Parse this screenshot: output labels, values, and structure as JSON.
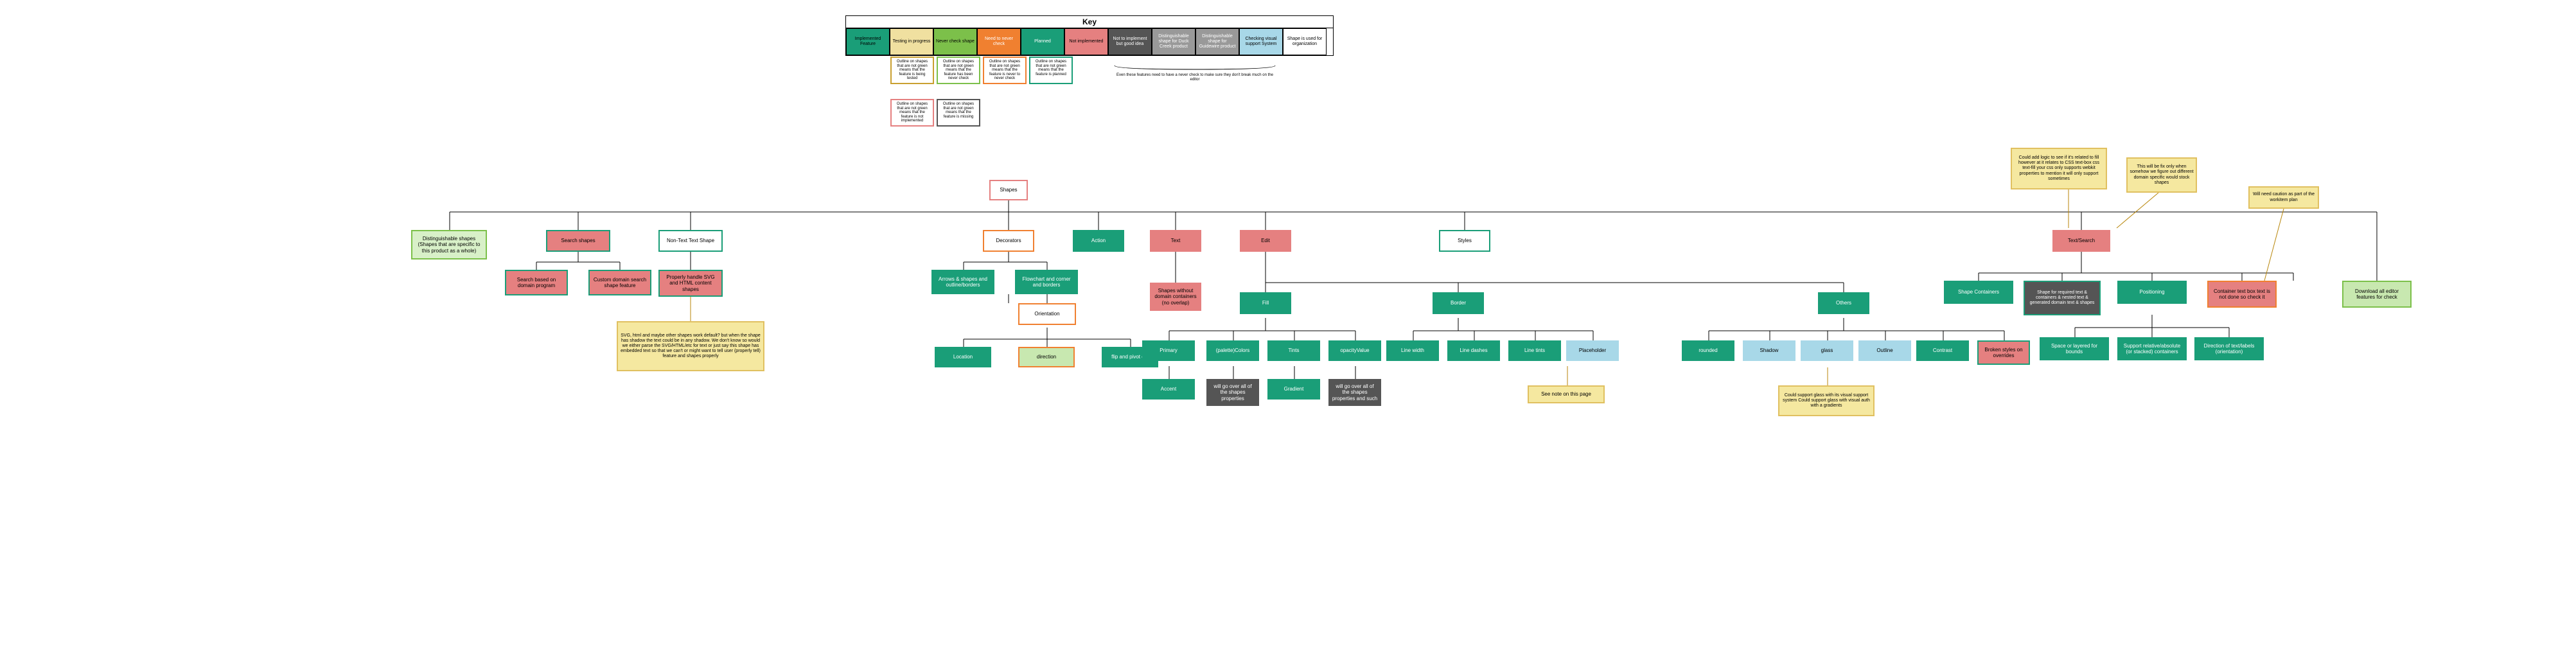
{
  "key": {
    "title": "Key",
    "cells": [
      {
        "label": "Implemented Feature",
        "bg": "#1a9e78",
        "fg": "#000",
        "border": "#000"
      },
      {
        "label": "Testing in progress",
        "bg": "#f0e0a0",
        "fg": "#000",
        "border": "#000"
      },
      {
        "label": "Never check shape",
        "bg": "#7cc04a",
        "fg": "#000",
        "border": "#000"
      },
      {
        "label": "Need to never check",
        "bg": "#f08030",
        "fg": "#fff",
        "border": "#000"
      },
      {
        "label": "Planned",
        "bg": "#1a9e78",
        "fg": "#fff",
        "border": "#000"
      },
      {
        "label": "Not implemented",
        "bg": "#e58080",
        "fg": "#000",
        "border": "#000"
      },
      {
        "label": "Not to implement but good idea",
        "bg": "#555",
        "fg": "#fff",
        "border": "#000"
      },
      {
        "label": "Distinguishable shape for Duck Creek product",
        "bg": "#999",
        "fg": "#fff",
        "border": "#000"
      },
      {
        "label": "Distinguishable shape for Guidewire product",
        "bg": "#999",
        "fg": "#fff",
        "border": "#000"
      },
      {
        "label": "Checking visual support System",
        "bg": "#a8d8e8",
        "fg": "#000",
        "border": "#000"
      },
      {
        "label": "Shape is used for organization",
        "bg": "#fff",
        "fg": "#000",
        "border": "#000"
      }
    ],
    "sub": [
      {
        "text": "Outline on shapes that are not green means that the feature is being tested",
        "border": "#c9a030",
        "bg": "#fff"
      },
      {
        "text": "Outline on shapes that are not green means that the feature has been never check",
        "border": "#7cc04a",
        "bg": "#fff"
      },
      {
        "text": "Outline on shapes that are not green means that the feature is never to never check",
        "border": "#f08030",
        "bg": "#fff"
      },
      {
        "text": "Outline on shapes that are not green means that the feature is planned",
        "border": "#1a9e78",
        "bg": "#fff"
      }
    ],
    "sub2": [
      {
        "text": "Outline on shapes that are not green means that the feature is not implemented",
        "border": "#e58080",
        "bg": "#fff"
      },
      {
        "text": "Outline on shapes that are not green means that the feature is missing",
        "border": "#555",
        "bg": "#fff"
      }
    ],
    "brace_text": "Even these features need to have a never check to make sure they don't break much on the editor"
  },
  "root": "Shapes",
  "b1": {
    "a": {
      "text": "Distinguishable shapes (Shapes that are specific to this product as a whole)",
      "border": "#7cc04a",
      "bg": "#d8f0c8"
    },
    "b": {
      "text": "Search shapes",
      "border": "#1a9e78",
      "bg": "#e58080"
    },
    "b1": {
      "text": "Search based on domain program",
      "border": "#1a9e78",
      "bg": "#e58080"
    },
    "b2": {
      "text": "Custom domain search shape feature",
      "border": "#1a9e78",
      "bg": "#e58080"
    },
    "c": {
      "text": "Non-Text Text Shape",
      "border": "#1a9e78",
      "bg": "#fff"
    },
    "c1": {
      "text": "Properly handle SVG and HTML content shapes",
      "border": "#1a9e78",
      "bg": "#e58080"
    },
    "note_c": "SVG, html and maybe other shapes work default? but when the shape has shadow the text could be in any shadow. We don't know so would we either parse the SVG/HTML/etc for text or just say this shape has embedded text so that we can't or might want to tell user (properly tell) feature and shapes properly"
  },
  "b2": {
    "root": "Decorators",
    "a": {
      "text": "Arrows & shapes and outline/borders",
      "border": "#1a9e78",
      "bg": "#1a9e78",
      "fg": "#fff"
    },
    "b": {
      "text": "Flowchart and corner and borders",
      "border": "#1a9e78",
      "bg": "#1a9e78",
      "fg": "#fff"
    }
  },
  "b3": {
    "root": "Orientation",
    "a": "Location",
    "b": {
      "text": "direction",
      "bg": "#c8e8b0",
      "border": "#f08030"
    },
    "c": "flip and pivot etc"
  },
  "b4": {
    "text": "Action",
    "border": "#1a9e78",
    "bg": "#1a9e78",
    "fg": "#fff"
  },
  "b5": {
    "root": {
      "text": "Text",
      "border": "#e58080",
      "bg": "#e58080"
    },
    "a": {
      "text": "Shapes without domain containers (no overlap)",
      "border": "#e58080",
      "bg": "#e58080"
    }
  },
  "b6": {
    "root": {
      "text": "Edit",
      "border": "#e58080",
      "bg": "#e58080"
    },
    "fill": {
      "root": "Fill",
      "a": "Primary",
      "b": "(palette)Colors",
      "c": "Tints",
      "d": "opacityValue",
      "sub_a": "Accent",
      "sub_b": {
        "text": "will go over all of the shapes properties",
        "bg": "#555",
        "fg": "#fff"
      },
      "sub_c": "Gradient",
      "sub_d": {
        "text": "will go over all of the shapes properties and such",
        "bg": "#555",
        "fg": "#fff"
      }
    },
    "border": {
      "root": "Border",
      "a": "Line width",
      "b": "Line dashes",
      "c": "Line tints",
      "d": {
        "text": "Placeholder",
        "bg": "#a8d8e8",
        "border": "#a8d8e8"
      },
      "note": "See note on this page"
    },
    "other": {
      "root": "Others",
      "a": "rounded",
      "b": {
        "text": "Shadow",
        "bg": "#a8d8e8",
        "border": "#a8d8e8"
      },
      "c": {
        "text": "glass",
        "bg": "#a8d8e8",
        "border": "#a8d8e8"
      },
      "d": {
        "text": "Outline",
        "bg": "#a8d8e8",
        "border": "#a8d8e8"
      },
      "e": "Contrast",
      "f": {
        "text": "Broken styles on overrides",
        "bg": "#e58080",
        "border": "#1a9e78"
      },
      "note": "Could support glass with its visual support system Could support glass with visual auth with a gradients"
    }
  },
  "b7": {
    "root": "Styles"
  },
  "b8": {
    "root": {
      "text": "Text/Search",
      "bg": "#e58080",
      "border": "#e58080"
    },
    "note1": "Could add logic to see if it's related to fill however at it relates to CSS text-box css text-fill your css only supports webkit properties to mention it will only support sometimes",
    "note2": "This will be fix only when somehow we figure out different domain specific would stock shapes",
    "note3": "Will need caution as part of the workitem plan",
    "a": {
      "text": "Shape Containers",
      "bg": "#1a9e78",
      "fg": "#fff",
      "border": "#1a9e78"
    },
    "b": {
      "text": "Shape for required text & containers & nested text & generated domain text & shapes",
      "bg": "#555",
      "fg": "#fff",
      "border": "#1a9e78"
    },
    "c": {
      "text": "Positioning",
      "bg": "#1a9e78",
      "fg": "#fff",
      "border": "#1a9e78"
    },
    "d": {
      "text": "Container text box text is not done so check it",
      "bg": "#e58080",
      "border": "#f08030"
    },
    "e": {
      "text": "Download all editor features for check",
      "bg": "#c8e8b0",
      "border": "#7cc04a"
    },
    "c1": "Space or layered for bounds",
    "c2": "Support relative/absolute (or stacked) containers",
    "c3": "Direction of text/labels (orientation)"
  }
}
